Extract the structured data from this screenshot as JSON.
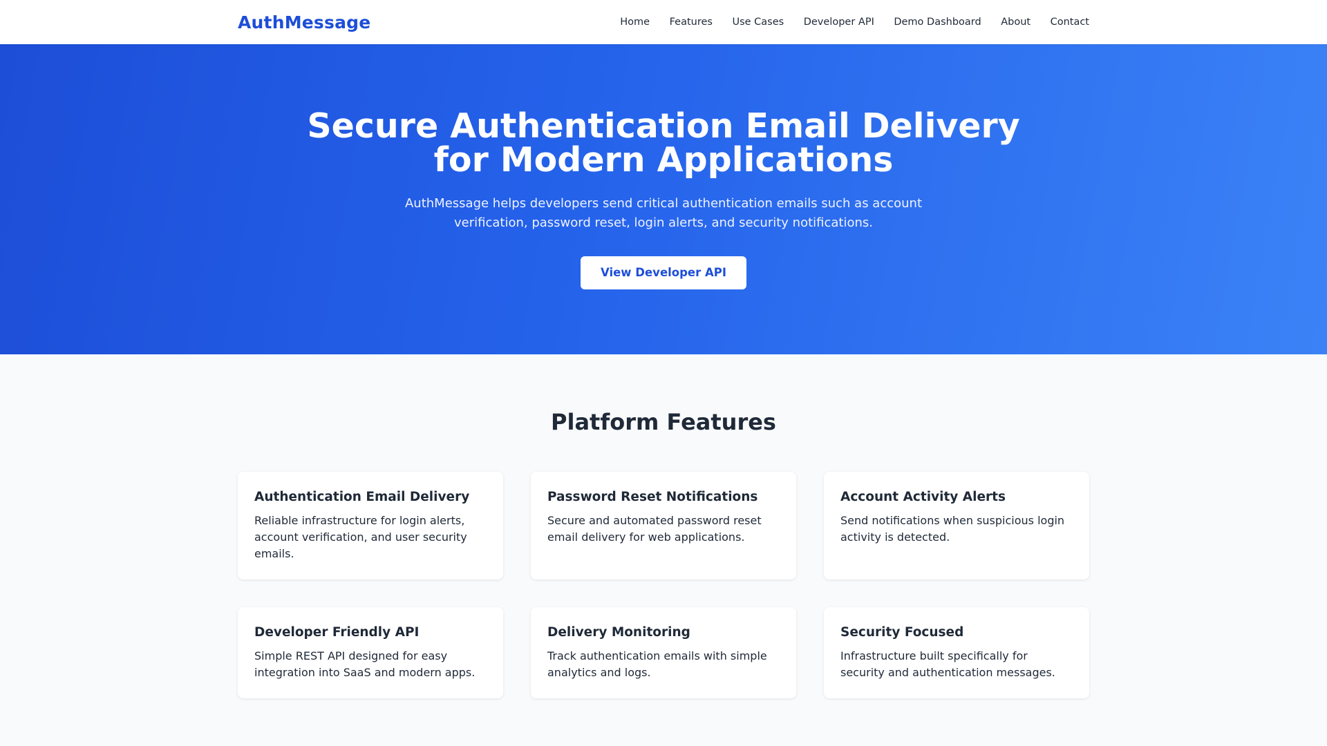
{
  "navbar": {
    "logo": "AuthMessage",
    "links": [
      {
        "label": "Home"
      },
      {
        "label": "Features"
      },
      {
        "label": "Use Cases"
      },
      {
        "label": "Developer API"
      },
      {
        "label": "Demo Dashboard"
      },
      {
        "label": "About"
      },
      {
        "label": "Contact"
      }
    ]
  },
  "hero": {
    "title_line1": "Secure Authentication Email Delivery",
    "title_line2": "for Modern Applications",
    "subtitle_line1": "AuthMessage helps developers send critical authentication emails such as account",
    "subtitle_line2": "verification, password reset, login alerts, and security notifications.",
    "button_label": "View Developer API"
  },
  "features": {
    "title": "Platform Features",
    "cards": [
      {
        "title": "Authentication Email Delivery",
        "lines": [
          "Reliable infrastructure for login alerts,",
          "account verification, and user security",
          "emails."
        ]
      },
      {
        "title": "Password Reset Notifications",
        "lines": [
          "Secure and automated password reset",
          "email delivery for web applications."
        ]
      },
      {
        "title": "Account Activity Alerts",
        "lines": [
          "Send notifications when suspicious login",
          "activity is detected."
        ]
      },
      {
        "title": "Developer Friendly API",
        "lines": [
          "Simple REST API designed for easy",
          "integration into SaaS and modern apps."
        ]
      },
      {
        "title": "Delivery Monitoring",
        "lines": [
          "Track authentication emails with simple",
          "analytics and logs."
        ]
      },
      {
        "title": "Security Focused",
        "lines": [
          "Infrastructure built specifically for",
          "security and authentication messages."
        ]
      }
    ]
  },
  "colors": {
    "brand": "#1d4ed8",
    "hero_gradient_start": "#1d4ed8",
    "hero_gradient_end": "#3b82f6",
    "background": "#f8fafc",
    "text": "#1f2937"
  }
}
